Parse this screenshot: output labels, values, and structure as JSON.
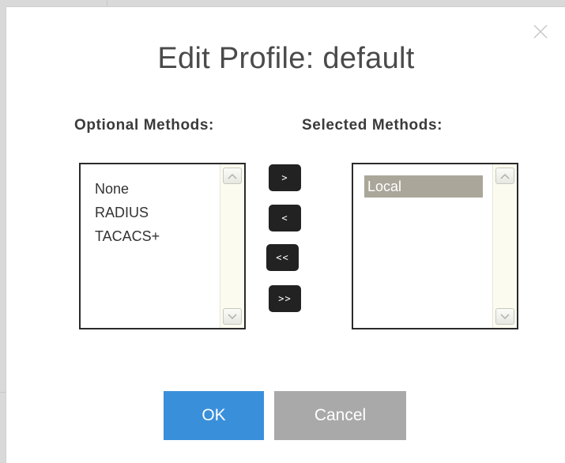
{
  "dialog": {
    "title": "Edit Profile: default",
    "close_icon": "close-icon"
  },
  "optional": {
    "label": "Optional Methods:",
    "items": [
      "None",
      "RADIUS",
      "TACACS+"
    ]
  },
  "selected": {
    "label": "Selected Methods:",
    "items": [
      "Local"
    ]
  },
  "move_buttons": {
    "add": ">",
    "remove": "<",
    "remove_all": "<<",
    "add_all": ">>"
  },
  "actions": {
    "ok": "OK",
    "cancel": "Cancel"
  },
  "colors": {
    "ok_bg": "#3a8fdb",
    "cancel_bg": "#a9a9a9",
    "move_bg": "#222222",
    "selected_item_bg": "#aaa69a"
  }
}
